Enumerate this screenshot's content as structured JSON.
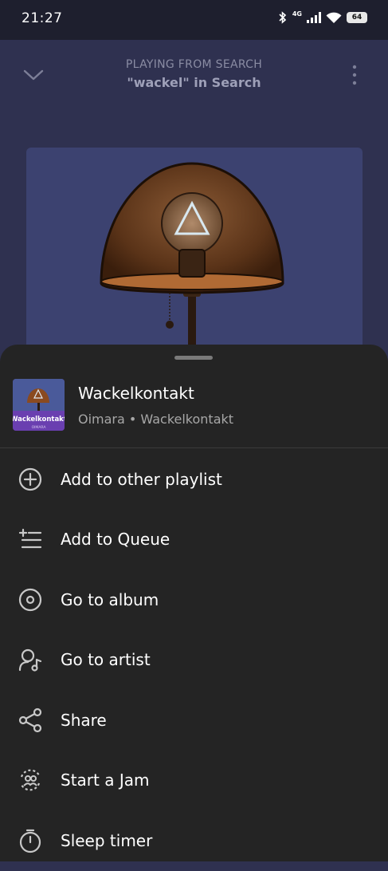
{
  "status_bar": {
    "time": "21:27",
    "network": "4G",
    "battery": "64"
  },
  "header": {
    "context_label": "PLAYING FROM SEARCH",
    "context_title": "\"wackel\" in Search"
  },
  "track": {
    "title": "Wackelkontakt",
    "subtitle": "Oimara • Wackelkontakt",
    "thumb_text": "Wackelkontakt",
    "thumb_subtext": "OIMARA"
  },
  "menu": {
    "items": [
      {
        "label": "Add to other playlist",
        "icon": "add-circle-icon"
      },
      {
        "label": "Add to Queue",
        "icon": "queue-icon"
      },
      {
        "label": "Go to album",
        "icon": "album-icon"
      },
      {
        "label": "Go to artist",
        "icon": "artist-icon"
      },
      {
        "label": "Share",
        "icon": "share-icon"
      },
      {
        "label": "Start a Jam",
        "icon": "jam-icon"
      },
      {
        "label": "Sleep timer",
        "icon": "timer-icon"
      }
    ]
  },
  "colors": {
    "sheet_bg": "#242424",
    "player_bg": "#2f3150",
    "artwork_bg": "#3c4270",
    "thumb_bg": "#5a3f9a"
  }
}
